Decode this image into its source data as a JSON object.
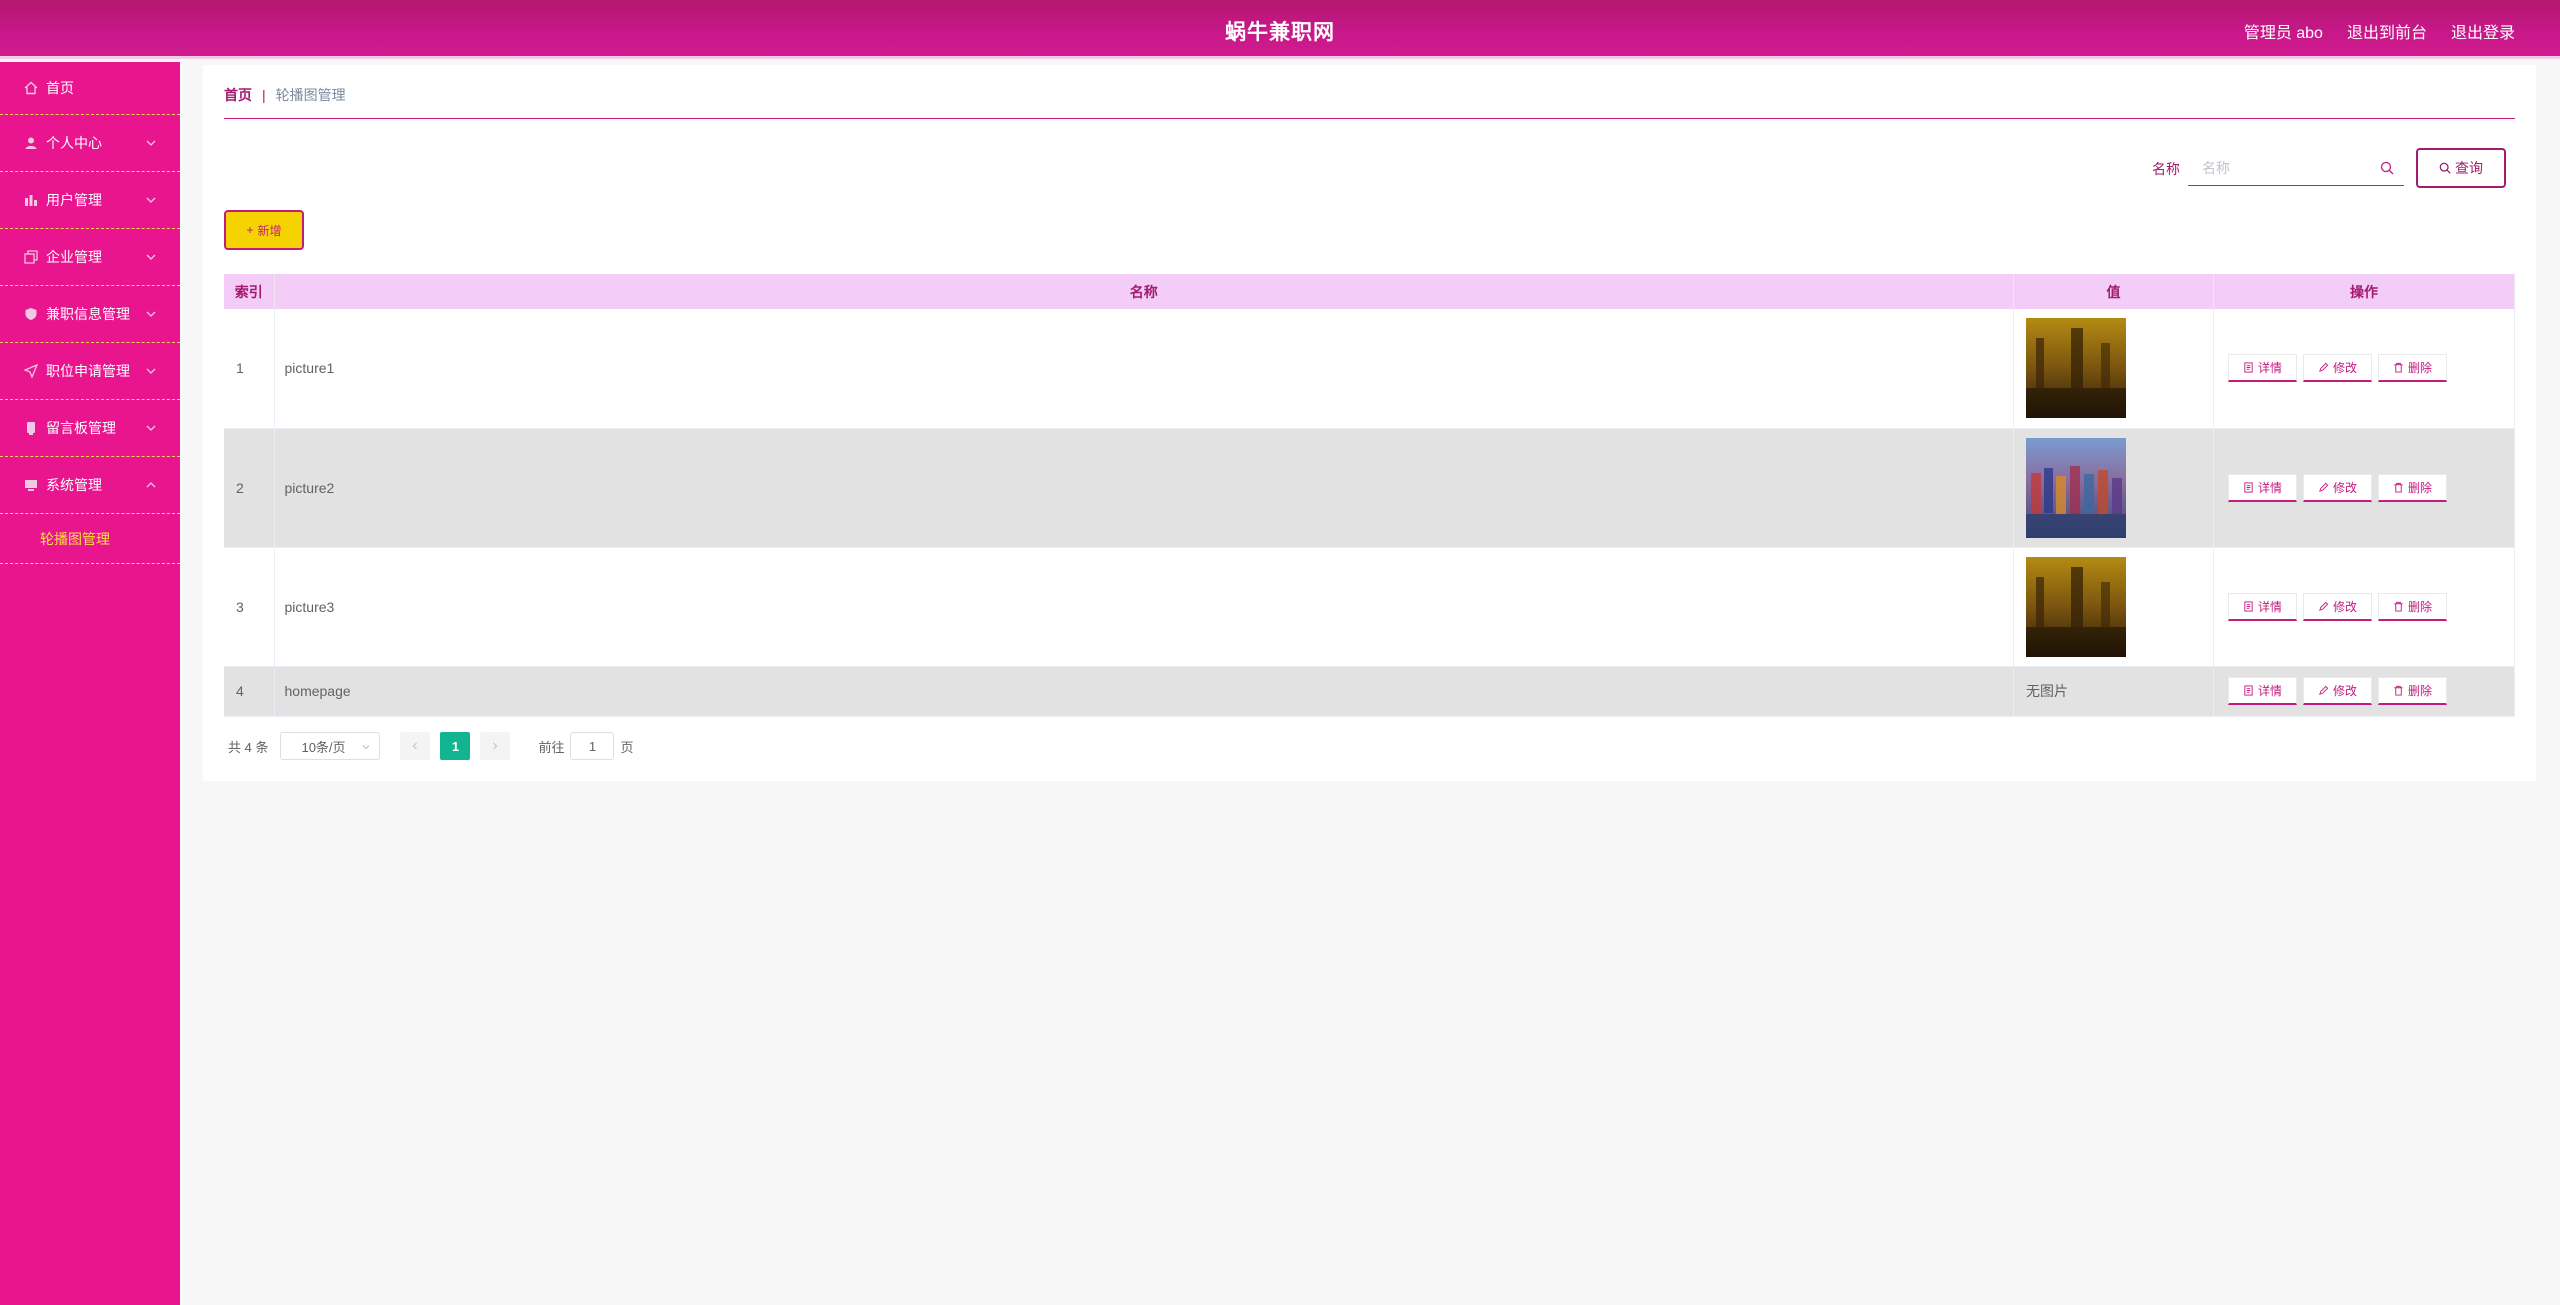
{
  "header": {
    "title": "蜗牛兼职网",
    "admin_label": "管理员 abo",
    "exit_front_label": "退出到前台",
    "logout_label": "退出登录"
  },
  "sidebar": {
    "items": [
      {
        "label": "首页",
        "icon": "home-icon"
      },
      {
        "label": "个人中心",
        "icon": "user-icon"
      },
      {
        "label": "用户管理",
        "icon": "chart-icon"
      },
      {
        "label": "企业管理",
        "icon": "copy-icon"
      },
      {
        "label": "兼职信息管理",
        "icon": "shield-icon"
      },
      {
        "label": "职位申请管理",
        "icon": "send-icon"
      },
      {
        "label": "留言板管理",
        "icon": "note-icon"
      },
      {
        "label": "系统管理",
        "icon": "monitor-icon"
      }
    ],
    "sub_item": "轮播图管理"
  },
  "breadcrumb": {
    "home": "首页",
    "separator": "|",
    "current": "轮播图管理"
  },
  "search": {
    "label": "名称",
    "placeholder": "名称",
    "query_label": "查询"
  },
  "toolbar": {
    "add_label": "新增"
  },
  "table": {
    "headers": [
      "索引",
      "名称",
      "值",
      "操作"
    ],
    "rows": [
      {
        "index": "1",
        "name": "picture1",
        "value": "image",
        "value_text": ""
      },
      {
        "index": "2",
        "name": "picture2",
        "value": "image",
        "value_text": ""
      },
      {
        "index": "3",
        "name": "picture3",
        "value": "image",
        "value_text": ""
      },
      {
        "index": "4",
        "name": "homepage",
        "value": "text",
        "value_text": "无图片"
      }
    ],
    "actions": {
      "detail": "详情",
      "edit": "修改",
      "delete": "删除"
    }
  },
  "pagination": {
    "total": "共 4 条",
    "page_size": "10条/页",
    "current_page": "1",
    "goto_label": "前往",
    "goto_value": "1",
    "page_suffix": "页"
  },
  "colors": {
    "topbar": "#c8188a",
    "sidebar": "#e8158f",
    "accent": "#a31a6e",
    "table_header": "#f3cdf7",
    "add_button": "#f5d300",
    "pager_active": "#13b591"
  }
}
